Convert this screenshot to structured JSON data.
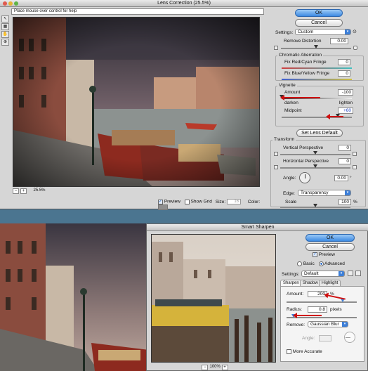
{
  "lens": {
    "title": "Lens Correction (25.5%)",
    "help": "Place mouse over control for help",
    "zoom": "25.5%",
    "zoom_minus": "−",
    "zoom_plus": "+",
    "preview_label": "Preview",
    "showgrid_label": "Show Grid",
    "size_label": "Size:",
    "size_value": "16",
    "color_label": "Color:",
    "ok": "OK",
    "cancel": "Cancel",
    "settings_label": "Settings:",
    "settings_value": "Custom",
    "remove_distortion_label": "Remove Distortion",
    "remove_distortion_value": "0.00",
    "chromatic_group": "Chromatic Aberration",
    "fix_rc_label": "Fix Red/Cyan Fringe",
    "fix_rc_value": "0",
    "fix_by_label": "Fix Blue/Yellow Fringe",
    "fix_by_value": "0",
    "vignette_group": "Vignette",
    "amount_label": "Amount",
    "amount_value": "-100",
    "darken": "darken",
    "lighten": "lighten",
    "midpoint_label": "Midpoint",
    "midpoint_value": "+60",
    "set_lens_default": "Set Lens Default",
    "transform_group": "Transform",
    "vertical_label": "Vertical Perspective",
    "vertical_value": "0",
    "horizontal_label": "Horizontal Perspective",
    "horizontal_value": "0",
    "angle_label": "Angle:",
    "angle_value": "0.00",
    "angle_unit": "°",
    "edge_label": "Edge:",
    "edge_value": "Transparency",
    "scale_label": "Scale",
    "scale_value": "100",
    "scale_unit": "%",
    "amount_level": 0.0,
    "midpoint_level": 0.8
  },
  "sharpen": {
    "title": "Smart Sharpen",
    "ok": "OK",
    "cancel": "Cancel",
    "preview_label": "Preview",
    "basic_label": "Basic",
    "advanced_label": "Advanced",
    "settings_label": "Settings:",
    "settings_value": "Default",
    "tab_sharpen": "Sharpen",
    "tab_shadow": "Shadow",
    "tab_highlight": "Highlight",
    "amount_label": "Amount:",
    "amount_value": "200",
    "amount_unit": "%",
    "radius_label": "Radius:",
    "radius_value": "0.8",
    "radius_unit": "pixels",
    "remove_label": "Remove:",
    "remove_value": "Gaussian Blur",
    "angle_label": "Angle:",
    "more_accurate_label": "More Accurate",
    "zoom": "100%",
    "zoom_minus": "−",
    "zoom_plus": "+",
    "amount_level": 0.8,
    "radius_level": 0.1
  },
  "tools": [
    "↖",
    "▦",
    "✋",
    "⊕",
    "🔍"
  ],
  "colors": {
    "accent": "#3d8ae2",
    "arrow": "#d01010"
  }
}
